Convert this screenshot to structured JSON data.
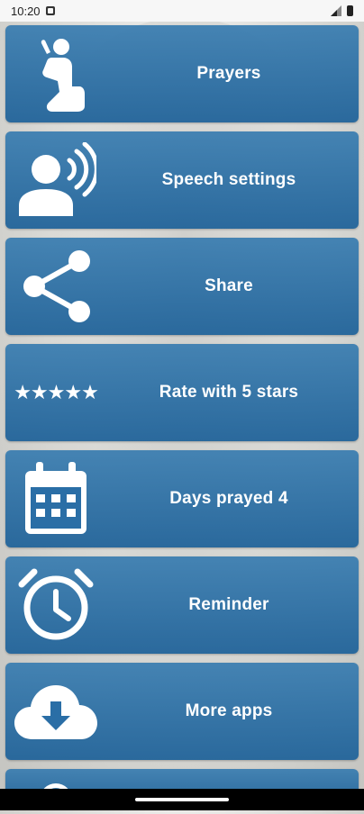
{
  "status_bar": {
    "time": "10:20"
  },
  "menu": {
    "items": [
      {
        "label": "Prayers",
        "icon": "praying-person-icon"
      },
      {
        "label": "Speech settings",
        "icon": "speaking-person-icon"
      },
      {
        "label": "Share",
        "icon": "share-icon"
      },
      {
        "label": "Rate with 5 stars",
        "icon": "five-stars-icon",
        "stars": "★★★★★"
      },
      {
        "label": "Days prayed 4",
        "icon": "calendar-icon"
      },
      {
        "label": "Reminder",
        "icon": "alarm-clock-icon"
      },
      {
        "label": "More apps",
        "icon": "cloud-download-icon"
      }
    ]
  },
  "colors": {
    "tile": "#2a6ea6",
    "icon": "#ffffff",
    "status_bar": "#f7f7f7",
    "nav_bar": "#000000"
  }
}
